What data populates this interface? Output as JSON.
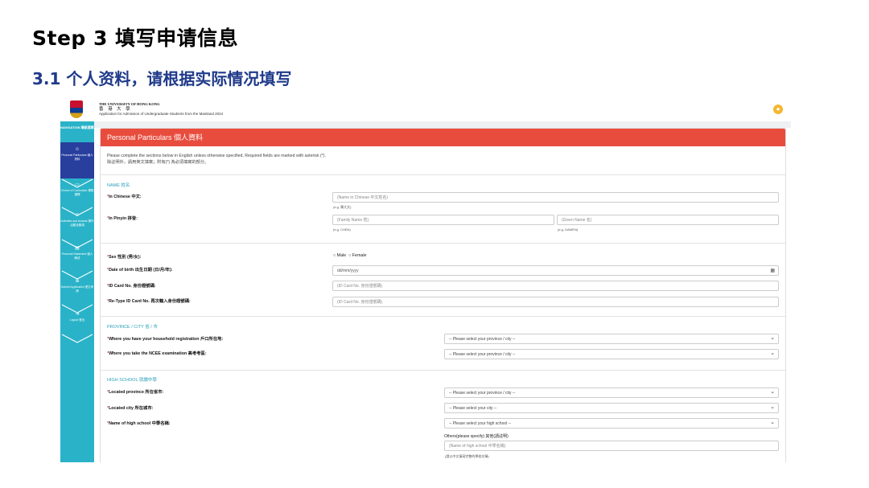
{
  "slide": {
    "title": "Step 3  填写申请信息",
    "subtitle": "3.1 个人资料，请根据实际情况填写"
  },
  "sidebar": {
    "nav_head": "NAVIGATION 導航選單",
    "items": [
      {
        "label": "Personal Particulars 個人資料",
        "icon": "user-icon"
      },
      {
        "label": "Choice of Curriculum 課程選擇",
        "icon": "book-icon"
      },
      {
        "label": "Activities and Awards 課外活動及獎項",
        "icon": "trophy-icon"
      },
      {
        "label": "Personal Statement 個人陳述",
        "icon": "document-icon"
      },
      {
        "label": "Submit Application 提交申請",
        "icon": "submit-icon"
      },
      {
        "label": "Logout 登出",
        "icon": "logout-icon"
      }
    ]
  },
  "header": {
    "uni_en": "THE UNIVERSITY OF HONG KONG",
    "uni_zh": "香 港 大 學",
    "app_title": "Application for Admission of Undergraduate Students from the Mainland 2024"
  },
  "panel": {
    "title": "Personal Particulars 個人資料",
    "intro_line1": "Please complete the sections below in English unless otherwise specified. Required fields are marked with asterisk (*).",
    "intro_line2": "除註明外，請用英文填寫；附有(*) 為必須填寫的部分。"
  },
  "name_section": {
    "heading": "NAME 姓名",
    "chinese_label": "In Chinese 中文:",
    "chinese_placeholder": "(Name in Chinese 中文姓名)",
    "chinese_hint": "(e.g. 陳大文)",
    "pinyin_label": "In Pinyin 拼音:",
    "family_placeholder": "(Family Name 姓)",
    "family_hint": "(e.g. CHEN)",
    "given_placeholder": "(Given Name 名)",
    "given_hint": "(e.g. DAWEN)"
  },
  "personal": {
    "sex_label": "Sex 性別 (男/女):",
    "male": "Male",
    "female": "Female",
    "dob_label": "Date of birth 出生日期 (日/月/年):",
    "dob_placeholder": "dd/mm/yyyy",
    "id_label": "ID Card No. 身份證號碼:",
    "id_placeholder": "(ID Card No. 身份證號碼)",
    "reid_label": "Re-Type ID Card No. 再次輸入身份證號碼:",
    "reid_placeholder": "(ID Card No. 身份證號碼)"
  },
  "province": {
    "heading": "PROVINCE / CITY 省 / 市",
    "household_label": "Where you have your household registration 戶口所在地:",
    "household_value": "-- Please select your province / city --",
    "ncee_label": "Where you take the NCEE examination 高考考區:",
    "ncee_value": "-- Please select your province / city --"
  },
  "school": {
    "heading": "HIGH SCHOOL 就讀中學",
    "prov_label": "Located province 所在省市:",
    "prov_value": "-- Please select your province / city --",
    "city_label": "Located city 所在城市:",
    "city_value": "-- Please select your city --",
    "name_label": "Name of high school 中學名稱:",
    "name_value": "-- Please select your high school --",
    "others_label": "Others(please specify) 其他(請註明)",
    "others_placeholder": "(Name of high school 中學名稱)",
    "others_hint": "(請以中文填寫完整的學校名稱)"
  }
}
